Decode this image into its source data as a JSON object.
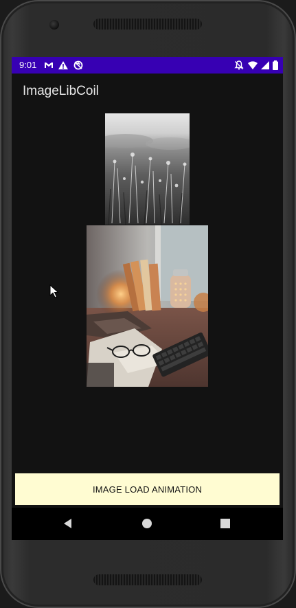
{
  "status_bar": {
    "time": "9:01",
    "background": "#3700b3",
    "left_icons": [
      "gmail-icon",
      "warning-icon",
      "sync-blocked-icon"
    ],
    "right_icons": [
      "notifications-off-icon",
      "wifi-icon",
      "signal-icon",
      "battery-icon"
    ]
  },
  "app": {
    "title": "ImageLibCoil"
  },
  "images": [
    {
      "name": "grayscale-grass-field-image",
      "style": "black-and-white"
    },
    {
      "name": "desk-still-life-image",
      "style": "warm-toned"
    }
  ],
  "button": {
    "label": "IMAGE LOAD ANIMATION",
    "background": "#fffcd2"
  },
  "navigation": {
    "buttons": [
      "back-icon",
      "home-icon",
      "recents-icon"
    ]
  }
}
